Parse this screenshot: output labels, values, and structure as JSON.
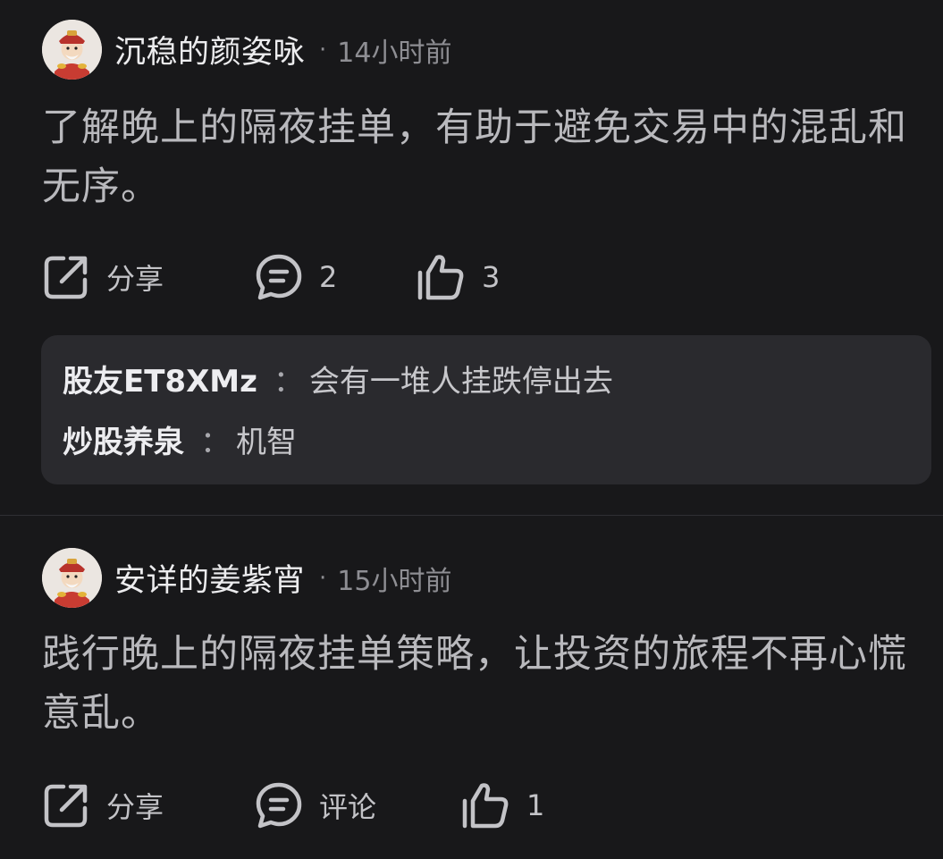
{
  "comments": [
    {
      "username": "沉稳的颜姿咏",
      "dot": "·",
      "time": "14小时前",
      "text": "了解晚上的隔夜挂单，有助于避免交易中的混乱和无序。",
      "actions": {
        "share_label": "分享",
        "comment_count": "2",
        "like_count": "3"
      },
      "replies": [
        {
          "name": "股友ET8XMz",
          "sep": "：",
          "text": "会有一堆人挂跌停出去"
        },
        {
          "name": "炒股养泉",
          "sep": "：",
          "text": "机智"
        }
      ]
    },
    {
      "username": "安详的姜紫宵",
      "dot": "·",
      "time": "15小时前",
      "text": "践行晚上的隔夜挂单策略，让投资的旅程不再心慌意乱。",
      "actions": {
        "share_label": "分享",
        "comment_label": "评论",
        "like_count": "1"
      }
    }
  ],
  "icons": {
    "share": "share-icon",
    "comment": "comment-bubble-icon",
    "like": "thumbs-up-icon",
    "avatar": "caishen-avatar"
  }
}
